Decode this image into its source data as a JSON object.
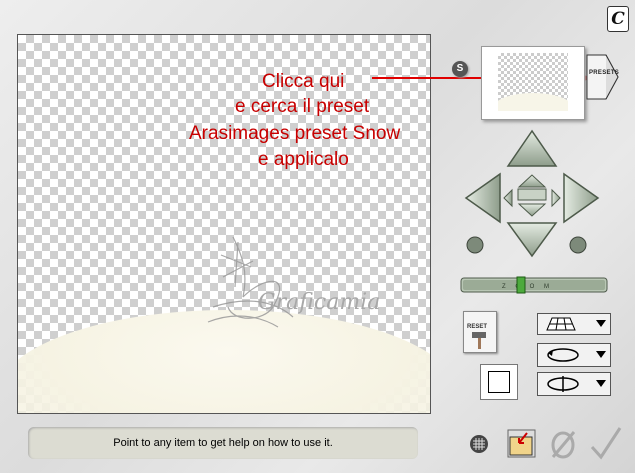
{
  "annotation": {
    "line1": "Clicca qui",
    "line2": "e cerca il preset",
    "line3": "Arasimages preset Snow",
    "line4": "e applicalo"
  },
  "preview": {
    "watermark_text": "Graficamia"
  },
  "status_bar": {
    "help_text": "Point to any item to get help on how to use it."
  },
  "presets": {
    "button_label": "PRESETS",
    "badge_label": "S"
  },
  "zoom": {
    "label": "Z O O M"
  },
  "tools": {
    "reset_label": "RESET"
  },
  "colors": {
    "annotation": "#c80000",
    "arrow": "#e00000",
    "button_green": "#b7c4b2"
  },
  "icons": {
    "logo": "corel-c-icon",
    "grid": "grid-icon",
    "folder": "load-file-icon",
    "cancel": "cancel-icon",
    "ok": "ok-checkmark-icon"
  }
}
